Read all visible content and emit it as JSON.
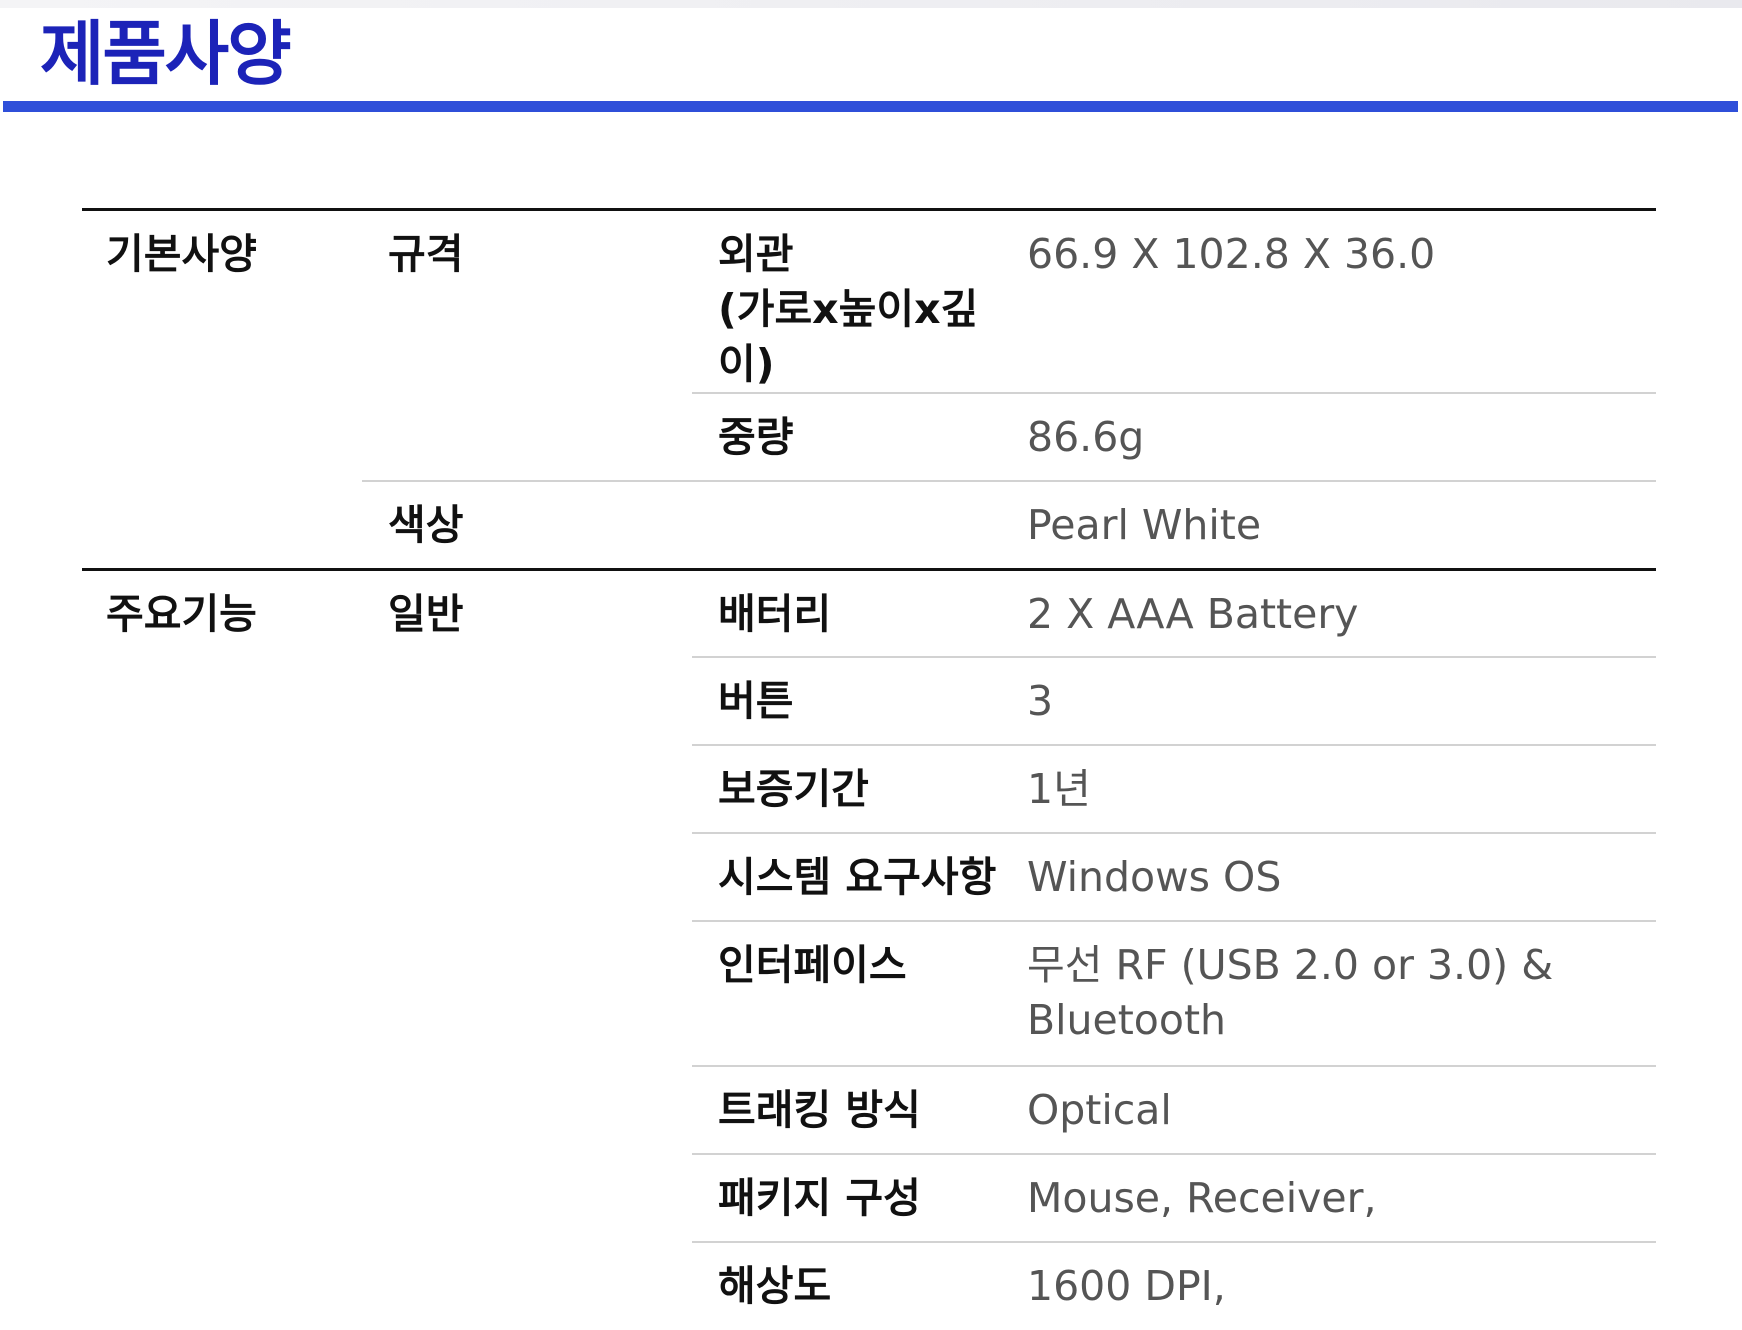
{
  "title": "제품사양",
  "sections": {
    "basic": {
      "label": "기본사양",
      "spec_label": "규격",
      "dimensions_label": "외관\n(가로x높이x깊이)",
      "dimensions_value": "66.9 X 102.8 X 36.0",
      "weight_label": "중량",
      "weight_value": "86.6g",
      "color_label": "색상",
      "color_value": "Pearl White"
    },
    "features": {
      "label": "주요기능",
      "general_label": "일반",
      "items": [
        {
          "label": "배터리",
          "value": "2 X AAA Battery"
        },
        {
          "label": "버튼",
          "value": "3"
        },
        {
          "label": "보증기간",
          "value": "1년"
        },
        {
          "label": "시스템 요구사항",
          "value": "Windows OS"
        },
        {
          "label": "인터페이스",
          "value": "무선 RF (USB 2.0 or 3.0) & Bluetooth"
        },
        {
          "label": "트래킹 방식",
          "value": "Optical"
        },
        {
          "label": "패키지 구성",
          "value": "Mouse, Receiver,"
        },
        {
          "label": "해상도",
          "value": "1600 DPI,"
        }
      ]
    }
  },
  "colors": {
    "title": "#1c23b8",
    "title_rule": "#2f4fd9",
    "header_text": "#111111",
    "value_text": "#555555"
  }
}
